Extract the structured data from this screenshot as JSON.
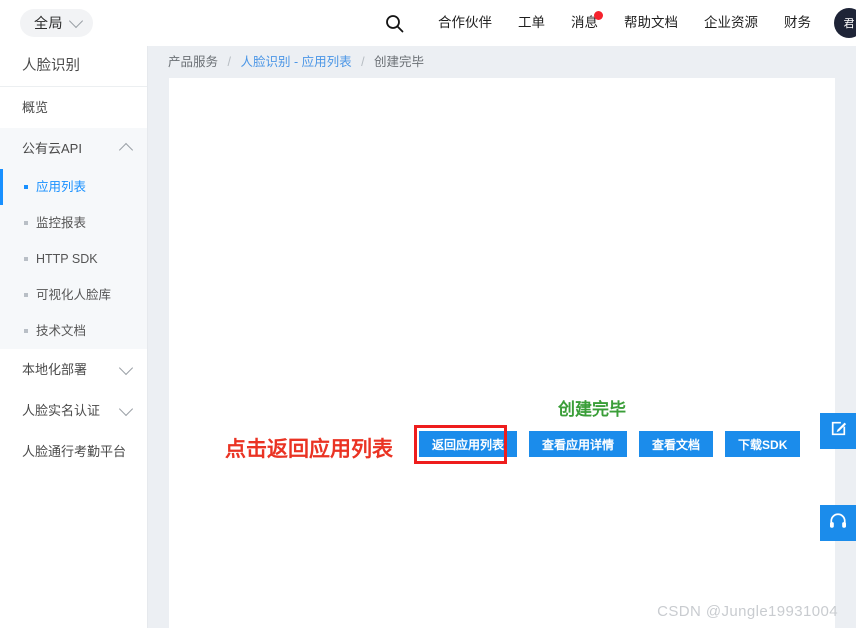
{
  "header": {
    "region_selector": {
      "label": "全局",
      "icon": "chevron-down-icon"
    },
    "search_icon": "search-icon",
    "nav": [
      {
        "label": "合作伙伴",
        "badge": false
      },
      {
        "label": "工单",
        "badge": false
      },
      {
        "label": "消息",
        "badge": true
      },
      {
        "label": "帮助文档",
        "badge": false
      },
      {
        "label": "企业资源",
        "badge": false
      },
      {
        "label": "财务",
        "badge": false
      }
    ],
    "avatar": {
      "initial": "君"
    }
  },
  "sidebar": {
    "title": "人脸识别",
    "items": [
      {
        "label": "概览",
        "type": "item"
      },
      {
        "label": "公有云API",
        "type": "group",
        "expanded": true,
        "icon": "chevron-up-icon"
      },
      {
        "label": "应用列表",
        "type": "sub",
        "active": true
      },
      {
        "label": "监控报表",
        "type": "sub",
        "active": false
      },
      {
        "label": "HTTP SDK",
        "type": "sub",
        "active": false
      },
      {
        "label": "可视化人脸库",
        "type": "sub",
        "active": false
      },
      {
        "label": "技术文档",
        "type": "sub",
        "active": false
      },
      {
        "label": "本地化部署",
        "type": "group",
        "expanded": false,
        "icon": "chevron-down-icon"
      },
      {
        "label": "人脸实名认证",
        "type": "group",
        "expanded": false,
        "icon": "chevron-down-icon"
      },
      {
        "label": "人脸通行考勤平台",
        "type": "item"
      }
    ]
  },
  "breadcrumb": {
    "items": [
      {
        "label": "产品服务",
        "link": false
      },
      {
        "label": "人脸识别 - 应用列表",
        "link": true
      },
      {
        "label": "创建完毕",
        "link": false
      }
    ],
    "separator": "/"
  },
  "main": {
    "status_note": "创建完毕",
    "status_note_color": "#3a9e38",
    "annotation": "点击返回应用列表",
    "annotation_color": "#ea3323",
    "highlight_color": "#ee1d1d",
    "accent_color": "#1b8ceb",
    "buttons": [
      {
        "label": "返回应用列表",
        "highlighted": true
      },
      {
        "label": "查看应用详情",
        "highlighted": false
      },
      {
        "label": "查看文档",
        "highlighted": false
      },
      {
        "label": "下载SDK",
        "highlighted": false
      }
    ]
  },
  "float_tools": [
    {
      "name": "feedback",
      "icon": "pencil-square-icon"
    },
    {
      "name": "support",
      "icon": "headset-icon"
    }
  ],
  "watermark": "CSDN @Jungle19931004"
}
